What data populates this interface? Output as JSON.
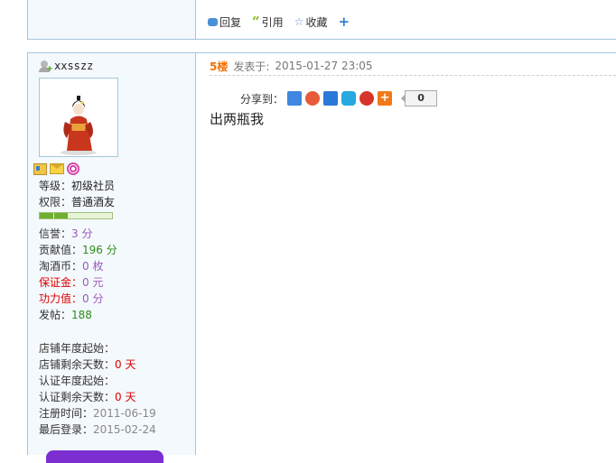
{
  "prev_post": {
    "actions": [
      {
        "label": "回复",
        "icon": "reply-icon"
      },
      {
        "label": "引用",
        "icon": "quote-icon"
      },
      {
        "label": "收藏",
        "icon": "favorite-icon"
      }
    ]
  },
  "user": {
    "username": "xxsszz",
    "level_label": "等级：",
    "level_value": "初级社员",
    "perm_label": "权限：",
    "perm_value": "普通酒友",
    "level_progress_segments": 2,
    "stats": [
      {
        "label": "信誉：",
        "value": "3 分",
        "label_color": "normal",
        "value_color": "purple"
      },
      {
        "label": "贡献值：",
        "value": "196 分",
        "label_color": "normal",
        "value_color": "green"
      },
      {
        "label": "淘酒币：",
        "value": "0 枚",
        "label_color": "normal",
        "value_color": "purple"
      },
      {
        "label": "保证金：",
        "value": "0 元",
        "label_color": "red",
        "value_color": "purple"
      },
      {
        "label": "功力值：",
        "value": "0 分",
        "label_color": "red",
        "value_color": "purple"
      },
      {
        "label": "发帖：",
        "value": "188",
        "label_color": "normal",
        "value_color": "green"
      }
    ],
    "shop": [
      {
        "label": "店铺年度起始：",
        "value": ""
      },
      {
        "label": "店铺剩余天数：",
        "value": "0 天",
        "value_color": "red"
      },
      {
        "label": "认证年度起始：",
        "value": ""
      },
      {
        "label": "认证剩余天数：",
        "value": "0 天",
        "value_color": "red"
      },
      {
        "label": "注册时间：",
        "value": "2011-06-19",
        "value_color": "gray"
      },
      {
        "label": "最后登录：",
        "value": "2015-02-24",
        "value_color": "gray"
      }
    ]
  },
  "post": {
    "floor": "5楼",
    "posted_label": "发表于:",
    "posted_time": "2015-01-27 23:05",
    "share_label": "分享到：",
    "share_count": "0",
    "body": "出两瓶我"
  }
}
